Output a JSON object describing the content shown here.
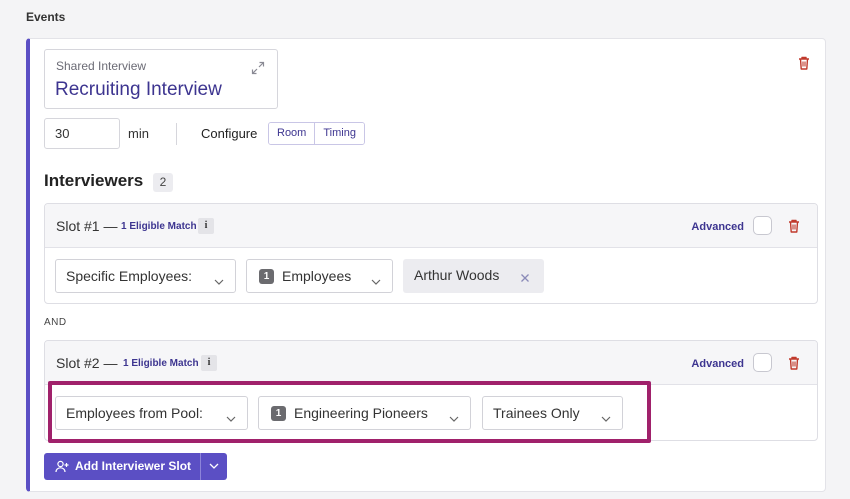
{
  "events": {
    "title": "Events",
    "interview": {
      "type_label": "Shared Interview",
      "name": "Recruiting Interview"
    },
    "duration": {
      "value": "30",
      "unit": "min"
    },
    "configure": {
      "label": "Configure",
      "options": [
        "Room",
        "Timing"
      ]
    },
    "interviewers": {
      "title": "Interviewers",
      "count": "2"
    },
    "and_label": "AND",
    "slots": [
      {
        "title": "Slot #1 —",
        "eligible": "1 Eligible Match",
        "info": "i",
        "advanced": "Advanced",
        "type_select": "Specific Employees:",
        "count_chip": "1",
        "group_select": "Employees",
        "tag": "Arthur Woods"
      },
      {
        "title": "Slot #2 —",
        "eligible": "1 Eligible Match",
        "info": "i",
        "advanced": "Advanced",
        "type_select": "Employees from Pool:",
        "count_chip": "1",
        "pool_select": "Engineering Pioneers",
        "filter_select": "Trainees Only"
      }
    ],
    "add_button": "Add Interviewer Slot"
  },
  "colors": {
    "accent": "#5b4fc4",
    "link": "#3d3590",
    "highlight": "#a0216b",
    "danger": "#c0392b"
  },
  "icons": [
    "trash-icon",
    "expand-icon",
    "info-icon",
    "chevron-down-icon",
    "close-icon",
    "add-user-icon"
  ]
}
